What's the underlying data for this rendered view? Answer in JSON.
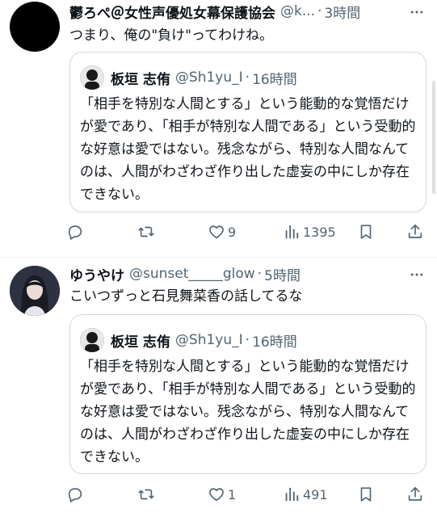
{
  "tweets": [
    {
      "display_name": "鬱ろぺ＠女性声優処女幕保護協会",
      "handle": "@k...",
      "separator": "·",
      "time": "3時間",
      "text": "つまり、俺の\"負け\"ってわけね。",
      "avatar_icon": "avatar-black",
      "quote": {
        "display_name": "板垣 志侑",
        "handle": "@Sh1yu_I",
        "separator": "·",
        "time": "16時間",
        "text": "「相手を特別な人間とする」という能動的な覚悟だけが愛であり、「相手が特別な人間である」という受動的な好意は愛ではない。残念ながら、特別な人間なんてのは、人間がわざわざ作り出した虚妄の中にしか存在できない。"
      },
      "actions": {
        "reply": "",
        "retweet": "",
        "like": "9",
        "views": "1395"
      }
    },
    {
      "display_name": "ゆうやけ",
      "handle": "@sunset_____glow",
      "separator": "·",
      "time": "5時間",
      "text": "こいつずっと石見舞菜香の話してるな",
      "avatar_icon": "avatar-anime-girl",
      "quote": {
        "display_name": "板垣 志侑",
        "handle": "@Sh1yu_I",
        "separator": "·",
        "time": "16時間",
        "text": "「相手を特別な人間とする」という能動的な覚悟だけが愛であり、「相手が特別な人間である」という受動的な好意は愛ではない。残念ながら、特別な人間なんてのは、人間がわざわざ作り出した虚妄の中にしか存在できない。"
      },
      "actions": {
        "reply": "",
        "retweet": "",
        "like": "1",
        "views": "491"
      }
    }
  ],
  "colors": {
    "text": "#0f1419",
    "secondary": "#536471",
    "border": "#cfd9de",
    "divider": "#eff3f4"
  }
}
